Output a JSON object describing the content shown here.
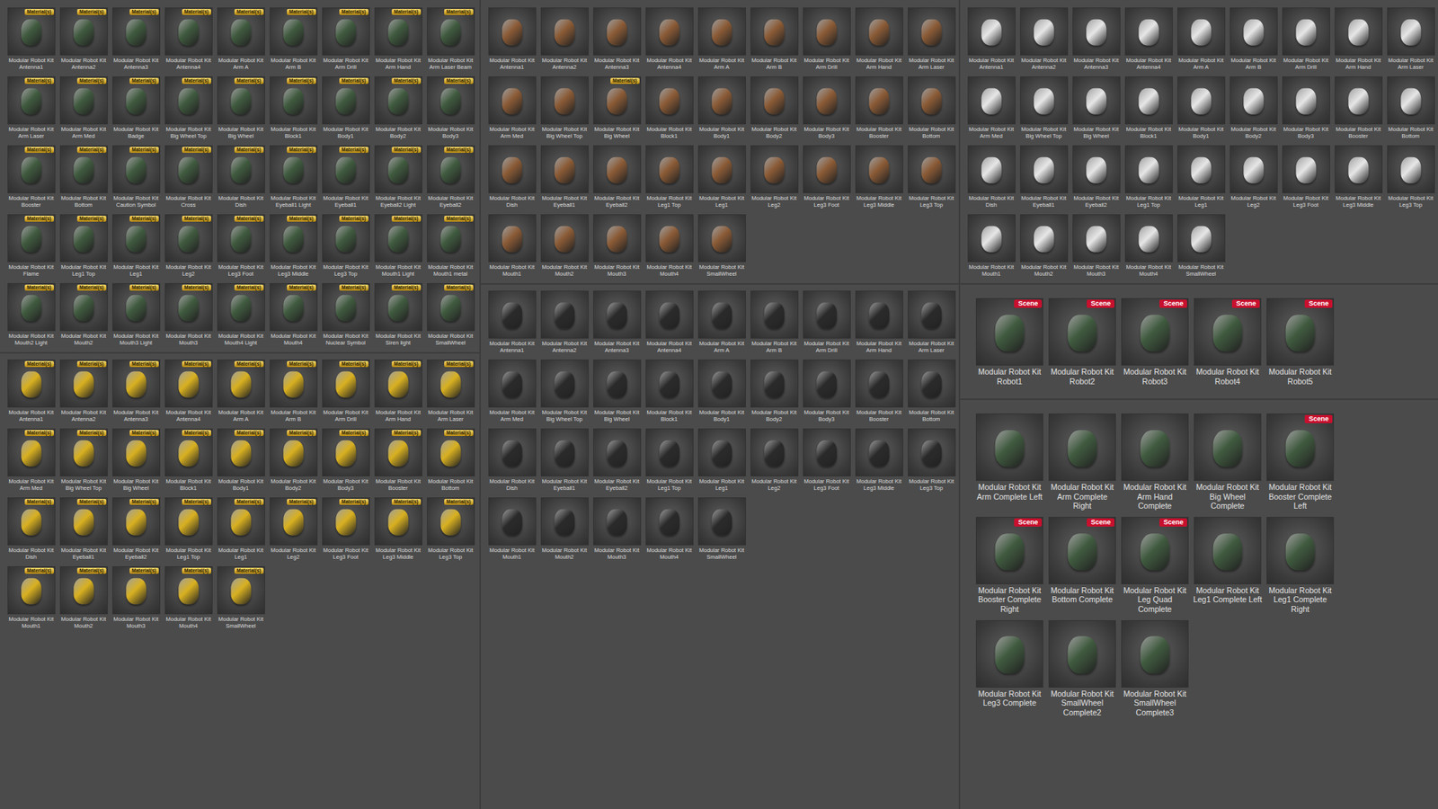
{
  "panels": [
    {
      "groups": [
        {
          "kind": "small",
          "color": "#3f5a3e",
          "items": [
            {
              "label": "Modular Robot Kit Antenna1",
              "badge": "Material(s)"
            },
            {
              "label": "Modular Robot Kit Antenna2",
              "badge": "Material(s)"
            },
            {
              "label": "Modular Robot Kit Antenna3",
              "badge": "Material(s)"
            },
            {
              "label": "Modular Robot Kit Antenna4",
              "badge": "Material(s)"
            },
            {
              "label": "Modular Robot Kit Arm A",
              "badge": "Material(s)"
            },
            {
              "label": "Modular Robot Kit Arm B",
              "badge": "Material(s)"
            },
            {
              "label": "Modular Robot Kit Arm Drill",
              "badge": "Material(s)"
            },
            {
              "label": "Modular Robot Kit Arm Hand",
              "badge": "Material(s)"
            },
            {
              "label": "Modular Robot Kit Arm Laser Beam",
              "badge": "Material(s)"
            },
            {
              "label": "Modular Robot Kit Arm Laser",
              "badge": "Material(s)"
            },
            {
              "label": "Modular Robot Kit Arm Med",
              "badge": "Material(s)"
            },
            {
              "label": "Modular Robot Kit Badge",
              "badge": "Material(s)"
            },
            {
              "label": "Modular Robot Kit Big Wheel Top",
              "badge": "Material(s)"
            },
            {
              "label": "Modular Robot Kit Big Wheel",
              "badge": "Material(s)"
            },
            {
              "label": "Modular Robot Kit Block1",
              "badge": "Material(s)"
            },
            {
              "label": "Modular Robot Kit Body1",
              "badge": "Material(s)"
            },
            {
              "label": "Modular Robot Kit Body2",
              "badge": "Material(s)"
            },
            {
              "label": "Modular Robot Kit Body3",
              "badge": "Material(s)"
            },
            {
              "label": "Modular Robot Kit Booster",
              "badge": "Material(s)"
            },
            {
              "label": "Modular Robot Kit Bottom",
              "badge": "Material(s)"
            },
            {
              "label": "Modular Robot Kit Caution Symbol",
              "badge": "Material(s)"
            },
            {
              "label": "Modular Robot Kit Cross",
              "badge": "Material(s)"
            },
            {
              "label": "Modular Robot Kit Dish",
              "badge": "Material(s)"
            },
            {
              "label": "Modular Robot Kit Eyeball1 Light",
              "badge": "Material(s)"
            },
            {
              "label": "Modular Robot Kit Eyeball1",
              "badge": "Material(s)"
            },
            {
              "label": "Modular Robot Kit Eyeball2 Light",
              "badge": "Material(s)"
            },
            {
              "label": "Modular Robot Kit Eyeball2",
              "badge": "Material(s)"
            },
            {
              "label": "Modular Robot Kit Flame",
              "badge": "Material(s)"
            },
            {
              "label": "Modular Robot Kit Leg1 Top",
              "badge": "Material(s)"
            },
            {
              "label": "Modular Robot Kit Leg1",
              "badge": "Material(s)"
            },
            {
              "label": "Modular Robot Kit Leg2",
              "badge": "Material(s)"
            },
            {
              "label": "Modular Robot Kit Leg3 Foot",
              "badge": "Material(s)"
            },
            {
              "label": "Modular Robot Kit Leg3 Middle",
              "badge": "Material(s)"
            },
            {
              "label": "Modular Robot Kit Leg3 Top",
              "badge": "Material(s)"
            },
            {
              "label": "Modular Robot Kit Mouth1 Light",
              "badge": "Material(s)"
            },
            {
              "label": "Modular Robot Kit Mouth1 metal",
              "badge": "Material(s)"
            },
            {
              "label": "Modular Robot Kit Mouth2 Light",
              "badge": "Material(s)"
            },
            {
              "label": "Modular Robot Kit Mouth2",
              "badge": "Material(s)"
            },
            {
              "label": "Modular Robot Kit Mouth3 Light",
              "badge": "Material(s)"
            },
            {
              "label": "Modular Robot Kit Mouth3",
              "badge": "Material(s)"
            },
            {
              "label": "Modular Robot Kit Mouth4 Light",
              "badge": "Material(s)"
            },
            {
              "label": "Modular Robot Kit Mouth4",
              "badge": "Material(s)"
            },
            {
              "label": "Modular Robot Kit Nuclear Symbol",
              "badge": "Material(s)"
            },
            {
              "label": "Modular Robot Kit Siren light",
              "badge": "Material(s)"
            },
            {
              "label": "Modular Robot Kit SmallWheel",
              "badge": "Material(s)"
            }
          ]
        },
        {
          "kind": "small",
          "color": "#d8b020",
          "items": [
            {
              "label": "Modular Robot Kit Antenna1",
              "badge": "Material(s)"
            },
            {
              "label": "Modular Robot Kit Antenna2",
              "badge": "Material(s)"
            },
            {
              "label": "Modular Robot Kit Antenna3",
              "badge": "Material(s)"
            },
            {
              "label": "Modular Robot Kit Antenna4",
              "badge": "Material(s)"
            },
            {
              "label": "Modular Robot Kit Arm A",
              "badge": "Material(s)"
            },
            {
              "label": "Modular Robot Kit Arm B",
              "badge": "Material(s)"
            },
            {
              "label": "Modular Robot Kit Arm Drill",
              "badge": "Material(s)"
            },
            {
              "label": "Modular Robot Kit Arm Hand",
              "badge": "Material(s)"
            },
            {
              "label": "Modular Robot Kit Arm Laser",
              "badge": "Material(s)"
            },
            {
              "label": "Modular Robot Kit Arm Med",
              "badge": "Material(s)"
            },
            {
              "label": "Modular Robot Kit Big Wheel Top",
              "badge": "Material(s)"
            },
            {
              "label": "Modular Robot Kit Big Wheel",
              "badge": "Material(s)"
            },
            {
              "label": "Modular Robot Kit Block1",
              "badge": "Material(s)"
            },
            {
              "label": "Modular Robot Kit Body1",
              "badge": "Material(s)"
            },
            {
              "label": "Modular Robot Kit Body2",
              "badge": "Material(s)"
            },
            {
              "label": "Modular Robot Kit Body3",
              "badge": "Material(s)"
            },
            {
              "label": "Modular Robot Kit Booster",
              "badge": "Material(s)"
            },
            {
              "label": "Modular Robot Kit Bottom",
              "badge": "Material(s)"
            },
            {
              "label": "Modular Robot Kit Dish",
              "badge": "Material(s)"
            },
            {
              "label": "Modular Robot Kit Eyeball1",
              "badge": "Material(s)"
            },
            {
              "label": "Modular Robot Kit Eyeball2",
              "badge": "Material(s)"
            },
            {
              "label": "Modular Robot Kit Leg1 Top",
              "badge": "Material(s)"
            },
            {
              "label": "Modular Robot Kit Leg1",
              "badge": "Material(s)"
            },
            {
              "label": "Modular Robot Kit Leg2",
              "badge": "Material(s)"
            },
            {
              "label": "Modular Robot Kit Leg3 Foot",
              "badge": "Material(s)"
            },
            {
              "label": "Modular Robot Kit Leg3 Middle",
              "badge": "Material(s)"
            },
            {
              "label": "Modular Robot Kit Leg3 Top",
              "badge": "Material(s)"
            },
            {
              "label": "Modular Robot Kit Mouth1",
              "badge": "Material(s)"
            },
            {
              "label": "Modular Robot Kit Mouth2",
              "badge": "Material(s)"
            },
            {
              "label": "Modular Robot Kit Mouth3",
              "badge": "Material(s)"
            },
            {
              "label": "Modular Robot Kit Mouth4",
              "badge": "Material(s)"
            },
            {
              "label": "Modular Robot Kit SmallWheel",
              "badge": "Material(s)"
            }
          ]
        }
      ]
    },
    {
      "groups": [
        {
          "kind": "small",
          "color": "#8a5a35",
          "items": [
            {
              "label": "Modular Robot Kit Antenna1"
            },
            {
              "label": "Modular Robot Kit Antenna2"
            },
            {
              "label": "Modular Robot Kit Antenna3"
            },
            {
              "label": "Modular Robot Kit Antenna4"
            },
            {
              "label": "Modular Robot Kit Arm A"
            },
            {
              "label": "Modular Robot Kit Arm B"
            },
            {
              "label": "Modular Robot Kit Arm Drill"
            },
            {
              "label": "Modular Robot Kit Arm Hand"
            },
            {
              "label": "Modular Robot Kit Arm Laser"
            },
            {
              "label": "Modular Robot Kit Arm Med"
            },
            {
              "label": "Modular Robot Kit Big Wheel Top"
            },
            {
              "label": "Modular Robot Kit Big Wheel",
              "badge": "Material(s)"
            },
            {
              "label": "Modular Robot Kit Block1"
            },
            {
              "label": "Modular Robot Kit Body1"
            },
            {
              "label": "Modular Robot Kit Body2"
            },
            {
              "label": "Modular Robot Kit Body3"
            },
            {
              "label": "Modular Robot Kit Booster"
            },
            {
              "label": "Modular Robot Kit Bottom"
            },
            {
              "label": "Modular Robot Kit Dish"
            },
            {
              "label": "Modular Robot Kit Eyeball1"
            },
            {
              "label": "Modular Robot Kit Eyeball2"
            },
            {
              "label": "Modular Robot Kit Leg1 Top"
            },
            {
              "label": "Modular Robot Kit Leg1"
            },
            {
              "label": "Modular Robot Kit Leg2"
            },
            {
              "label": "Modular Robot Kit Leg3 Foot"
            },
            {
              "label": "Modular Robot Kit Leg3 Middle"
            },
            {
              "label": "Modular Robot Kit Leg3 Top"
            },
            {
              "label": "Modular Robot Kit Mouth1"
            },
            {
              "label": "Modular Robot Kit Mouth2"
            },
            {
              "label": "Modular Robot Kit Mouth3"
            },
            {
              "label": "Modular Robot Kit Mouth4"
            },
            {
              "label": "Modular Robot Kit SmallWheel"
            }
          ]
        },
        {
          "kind": "small",
          "color": "#2a2a2a",
          "items": [
            {
              "label": "Modular Robot Kit Antenna1"
            },
            {
              "label": "Modular Robot Kit Antenna2"
            },
            {
              "label": "Modular Robot Kit Antenna3"
            },
            {
              "label": "Modular Robot Kit Antenna4"
            },
            {
              "label": "Modular Robot Kit Arm A"
            },
            {
              "label": "Modular Robot Kit Arm B"
            },
            {
              "label": "Modular Robot Kit Arm Drill"
            },
            {
              "label": "Modular Robot Kit Arm Hand"
            },
            {
              "label": "Modular Robot Kit Arm Laser"
            },
            {
              "label": "Modular Robot Kit Arm Med"
            },
            {
              "label": "Modular Robot Kit Big Wheel Top"
            },
            {
              "label": "Modular Robot Kit Big Wheel"
            },
            {
              "label": "Modular Robot Kit Block1"
            },
            {
              "label": "Modular Robot Kit Body1"
            },
            {
              "label": "Modular Robot Kit Body2"
            },
            {
              "label": "Modular Robot Kit Body3"
            },
            {
              "label": "Modular Robot Kit Booster"
            },
            {
              "label": "Modular Robot Kit Bottom"
            },
            {
              "label": "Modular Robot Kit Dish"
            },
            {
              "label": "Modular Robot Kit Eyeball1"
            },
            {
              "label": "Modular Robot Kit Eyeball2"
            },
            {
              "label": "Modular Robot Kit Leg1 Top"
            },
            {
              "label": "Modular Robot Kit Leg1"
            },
            {
              "label": "Modular Robot Kit Leg2"
            },
            {
              "label": "Modular Robot Kit Leg3 Foot"
            },
            {
              "label": "Modular Robot Kit Leg3 Middle"
            },
            {
              "label": "Modular Robot Kit Leg3 Top"
            },
            {
              "label": "Modular Robot Kit Mouth1"
            },
            {
              "label": "Modular Robot Kit Mouth2"
            },
            {
              "label": "Modular Robot Kit Mouth3"
            },
            {
              "label": "Modular Robot Kit Mouth4"
            },
            {
              "label": "Modular Robot Kit SmallWheel"
            }
          ]
        }
      ]
    },
    {
      "groups": [
        {
          "kind": "small",
          "color": "#e6e6e6",
          "items": [
            {
              "label": "Modular Robot Kit Antenna1"
            },
            {
              "label": "Modular Robot Kit Antenna2"
            },
            {
              "label": "Modular Robot Kit Antenna3"
            },
            {
              "label": "Modular Robot Kit Antenna4"
            },
            {
              "label": "Modular Robot Kit Arm A"
            },
            {
              "label": "Modular Robot Kit Arm B"
            },
            {
              "label": "Modular Robot Kit Arm Drill"
            },
            {
              "label": "Modular Robot Kit Arm Hand"
            },
            {
              "label": "Modular Robot Kit Arm Laser"
            },
            {
              "label": "Modular Robot Kit Arm Med"
            },
            {
              "label": "Modular Robot Kit Big Wheel Top"
            },
            {
              "label": "Modular Robot Kit Big Wheel"
            },
            {
              "label": "Modular Robot Kit Block1"
            },
            {
              "label": "Modular Robot Kit Body1"
            },
            {
              "label": "Modular Robot Kit Body2"
            },
            {
              "label": "Modular Robot Kit Body3"
            },
            {
              "label": "Modular Robot Kit Booster"
            },
            {
              "label": "Modular Robot Kit Bottom"
            },
            {
              "label": "Modular Robot Kit Dish"
            },
            {
              "label": "Modular Robot Kit Eyeball1"
            },
            {
              "label": "Modular Robot Kit Eyeball2"
            },
            {
              "label": "Modular Robot Kit Leg1 Top"
            },
            {
              "label": "Modular Robot Kit Leg1"
            },
            {
              "label": "Modular Robot Kit Leg2"
            },
            {
              "label": "Modular Robot Kit Leg3 Foot"
            },
            {
              "label": "Modular Robot Kit Leg3 Middle"
            },
            {
              "label": "Modular Robot Kit Leg3 Top"
            },
            {
              "label": "Modular Robot Kit Mouth1"
            },
            {
              "label": "Modular Robot Kit Mouth2"
            },
            {
              "label": "Modular Robot Kit Mouth3"
            },
            {
              "label": "Modular Robot Kit Mouth4"
            },
            {
              "label": "Modular Robot Kit SmallWheel"
            }
          ]
        },
        {
          "kind": "large",
          "color": "#3f5a3e",
          "items": [
            {
              "label": "Modular Robot Kit Robot1",
              "badge": "Scene"
            },
            {
              "label": "Modular Robot Kit Robot2",
              "badge": "Scene"
            },
            {
              "label": "Modular Robot Kit Robot3",
              "badge": "Scene"
            },
            {
              "label": "Modular Robot Kit Robot4",
              "badge": "Scene"
            },
            {
              "label": "Modular Robot Kit Robot5",
              "badge": "Scene"
            }
          ]
        },
        {
          "kind": "large",
          "color": "#3f5a3e",
          "items": [
            {
              "label": "Modular Robot Kit Arm Complete Left"
            },
            {
              "label": "Modular Robot Kit Arm Complete Right"
            },
            {
              "label": "Modular Robot Kit Arm Hand Complete"
            },
            {
              "label": "Modular Robot Kit Big Wheel Complete"
            },
            {
              "label": "Modular Robot Kit Booster Complete Left",
              "badge": "Scene"
            },
            {
              "label": "Modular Robot Kit Booster Complete Right",
              "badge": "Scene"
            },
            {
              "label": "Modular Robot Kit Bottom Complete",
              "badge": "Scene"
            },
            {
              "label": "Modular Robot Kit Leg Quad Complete",
              "badge": "Scene"
            },
            {
              "label": "Modular Robot Kit Leg1 Complete Left"
            },
            {
              "label": "Modular Robot Kit Leg1 Complete Right"
            },
            {
              "label": "Modular Robot Kit Leg3 Complete"
            },
            {
              "label": "Modular Robot Kit SmallWheel Complete2"
            },
            {
              "label": "Modular Robot Kit SmallWheel Complete3"
            }
          ]
        }
      ]
    }
  ]
}
